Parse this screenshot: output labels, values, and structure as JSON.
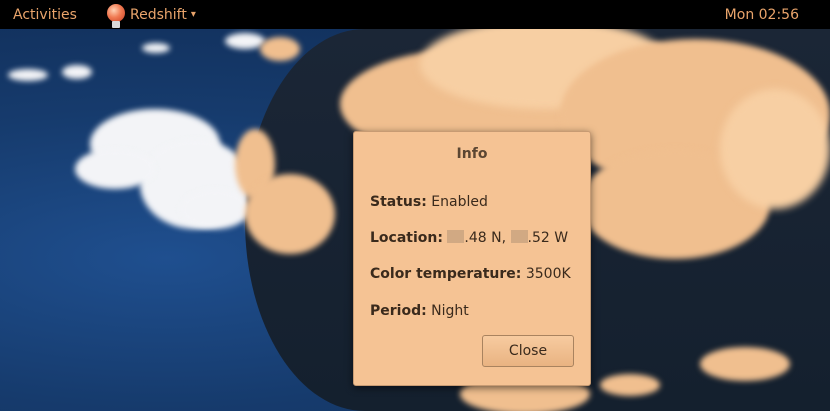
{
  "top_panel": {
    "activities_label": "Activities",
    "app_name": "Redshift",
    "app_caret": "▾",
    "clock": "Mon 02:56"
  },
  "dialog": {
    "title": "Info",
    "status_label": "Status:",
    "status_value": "Enabled",
    "location_label": "Location:",
    "location_lat": ".48 N,",
    "location_lon": ".52 W",
    "temp_label": "Color temperature:",
    "temp_value": "3500K",
    "period_label": "Period:",
    "period_value": "Night",
    "close_label": "Close"
  },
  "colors": {
    "panel_text": "#e9a46b",
    "dialog_bg": "#f5c394"
  },
  "icons": {
    "app_icon": "redshift-bulb-icon"
  }
}
